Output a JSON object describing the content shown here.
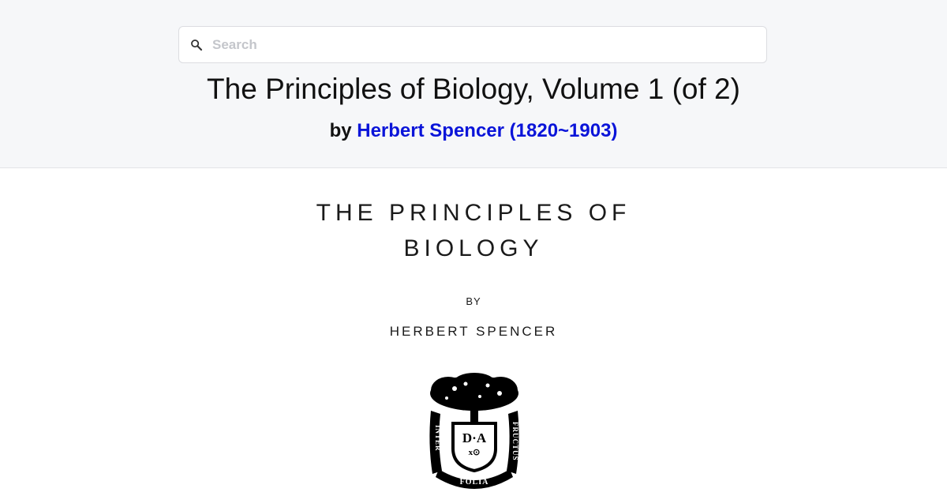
{
  "search": {
    "placeholder": "Search",
    "value": ""
  },
  "header": {
    "title": "The Principles of Biology, Volume 1 (of 2)",
    "by_prefix": "by",
    "author_link": "Herbert Spencer (1820~1903)"
  },
  "content": {
    "title_line1": "THE PRINCIPLES OF",
    "title_line2": "BIOLOGY",
    "by": "BY",
    "author": "HERBERT SPENCER"
  },
  "emblem": {
    "left_text": "INTER",
    "right_text": "FRUCTUS",
    "bottom_text": "FOLIA",
    "monogram": "D·A"
  },
  "colors": {
    "header_bg": "#f6f7f9",
    "link": "#0a14d9"
  }
}
